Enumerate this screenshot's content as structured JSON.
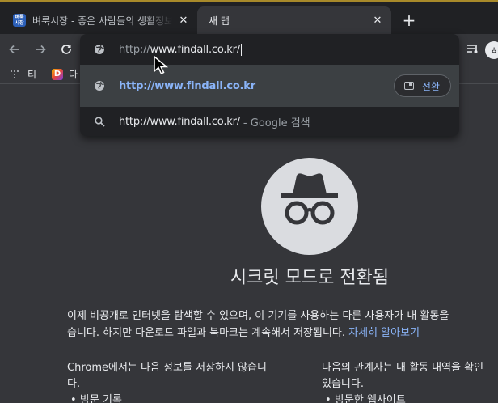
{
  "tabs": [
    {
      "favicon_text": "벼룩시장",
      "title": "벼룩시장 - 좋은 사람들의 생활정보",
      "close": "✕"
    },
    {
      "title": "새 탭",
      "close": "✕"
    }
  ],
  "new_tab_symbol": "+",
  "toolbar": {
    "back": "←",
    "forward": "→",
    "reload": "C"
  },
  "profile_initial": "ㅎ",
  "bookmarks": [
    {
      "label": "티"
    },
    {
      "label": "다",
      "icon_letter": "D"
    }
  ],
  "omnibox": {
    "input_prefix": "http://",
    "input_text": "www.findall.co.kr/",
    "suggestions": [
      {
        "icon": "globe-icon",
        "text": "http://www.findall.co.kr",
        "action": "전환"
      },
      {
        "icon": "search-icon",
        "text": "http://www.findall.co.kr/",
        "suffix": "- Google 검색"
      }
    ]
  },
  "content": {
    "heading": "시크릿 모드로 전환됨",
    "paragraph_line1": "이제 비공개로 인터넷을 탐색할 수 있으며, 이 기기를 사용하는 다른 사용자가 내 활동을",
    "paragraph_line2": "습니다. 하지만 다운로드 파일과 북마크는 계속해서 저장됩니다.",
    "learn_more": "자세히 알아보기",
    "col1_line1": "Chrome에서는 다음 정보를 저장하지 않습니",
    "col1_line2": "다.",
    "col1_bullet": "방문 기록",
    "col2_line1": "다음의 관계자는 내 활동 내역을 확인",
    "col2_line2": "있습니다.",
    "col2_bullet": "방문한 웹사이트"
  },
  "colors": {
    "accent": "#8ab4f8",
    "background": "#35363a",
    "tabstrip": "#202124"
  }
}
